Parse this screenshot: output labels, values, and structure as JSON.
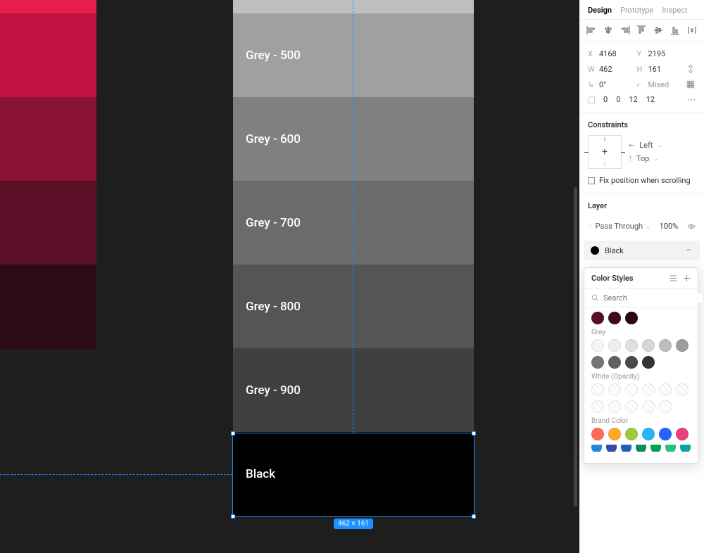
{
  "tabs": {
    "design": "Design",
    "prototype": "Prototype",
    "inspect": "Inspect"
  },
  "props": {
    "x_label": "X",
    "x": "4168",
    "y_label": "Y",
    "y": "2195",
    "w_label": "W",
    "w": "462",
    "h_label": "H",
    "h": "161",
    "rot_label": "⟲",
    "rot": "0°",
    "flip_label": "⟳",
    "flip": "Mixed",
    "radii": [
      "0",
      "0",
      "12",
      "12"
    ]
  },
  "constraints": {
    "title": "Constraints",
    "horiz": "Left",
    "vert": "Top",
    "fix": "Fix position when scrolling"
  },
  "layer": {
    "title": "Layer",
    "blend": "Pass Through",
    "opacity": "100%"
  },
  "fill": {
    "name": "Black"
  },
  "popover": {
    "title": "Color Styles",
    "search_placeholder": "Search",
    "groups": {
      "dark_reds": [
        "#5a0f27",
        "#3d0a1b",
        "#2a0712"
      ],
      "grey_label": "Grey",
      "greys": [
        "#f5f5f5",
        "#eeeeee",
        "#e0e0e0",
        "#d6d6d6",
        "#bdbdbd",
        "#9e9e9e",
        "#757575",
        "#616161",
        "#4a4a4a",
        "#333333"
      ],
      "white_label": "White (Opacity)",
      "brand_label": "Brand Color",
      "brand": [
        "#ff6b5b",
        "#ffa726",
        "#9ccc3d",
        "#29b6f6",
        "#2962ff",
        "#ec407a",
        "#1e88e5",
        "#3949ab",
        "#1565c0",
        "#0d8a57",
        "#00a152",
        "#26c281",
        "#0aa3a3"
      ]
    }
  },
  "swatches": {
    "g500": "Grey - 500",
    "g600": "Grey - 600",
    "g700": "Grey - 700",
    "g800": "Grey - 800",
    "g900": "Grey - 900",
    "black": "Black"
  },
  "selection": {
    "dim": "462 × 161"
  }
}
